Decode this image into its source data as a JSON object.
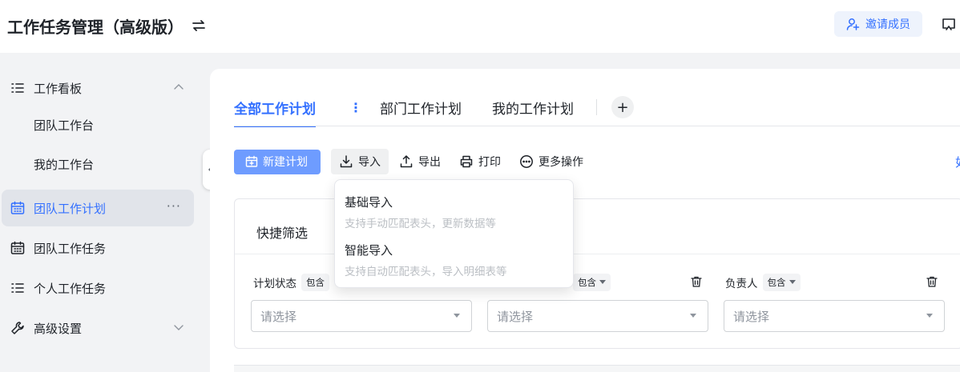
{
  "app": {
    "title": "工作任务管理（高级版）"
  },
  "header": {
    "invite_label": "邀请成员"
  },
  "sidebar": {
    "items": [
      {
        "label": "工作看板"
      },
      {
        "label": "团队工作台"
      },
      {
        "label": "我的工作台"
      },
      {
        "label": "团队工作计划",
        "more": "···"
      },
      {
        "label": "团队工作任务"
      },
      {
        "label": "个人工作任务"
      },
      {
        "label": "高级设置"
      }
    ]
  },
  "tabs": [
    {
      "label": "全部工作计划"
    },
    {
      "label": "部门工作计划"
    },
    {
      "label": "我的工作计划"
    }
  ],
  "tabs_extra": {
    "menu_glyph": "⋮",
    "add_glyph": "+"
  },
  "toolbar": {
    "new_plan": "新建计划",
    "import": "导入",
    "export": "导出",
    "print": "打印",
    "more": "更多操作",
    "edge_fragment": "如"
  },
  "filters": {
    "title": "快捷筛选",
    "fields": [
      {
        "label": "计划状态",
        "op": "包含",
        "placeholder": "请选择"
      },
      {
        "label": "",
        "op": "包含",
        "placeholder": "请选择"
      },
      {
        "label": "负责人",
        "op": "包含",
        "placeholder": "请选择"
      }
    ]
  },
  "import_menu": [
    {
      "title": "基础导入",
      "desc": "支持手动匹配表头，更新数据等"
    },
    {
      "title": "智能导入",
      "desc": "支持自动匹配表头，导入明细表等"
    }
  ],
  "colors": {
    "accent": "#3370ff",
    "primary_button": "#6e9cff",
    "active_nav_bg": "#e1e4ea"
  }
}
